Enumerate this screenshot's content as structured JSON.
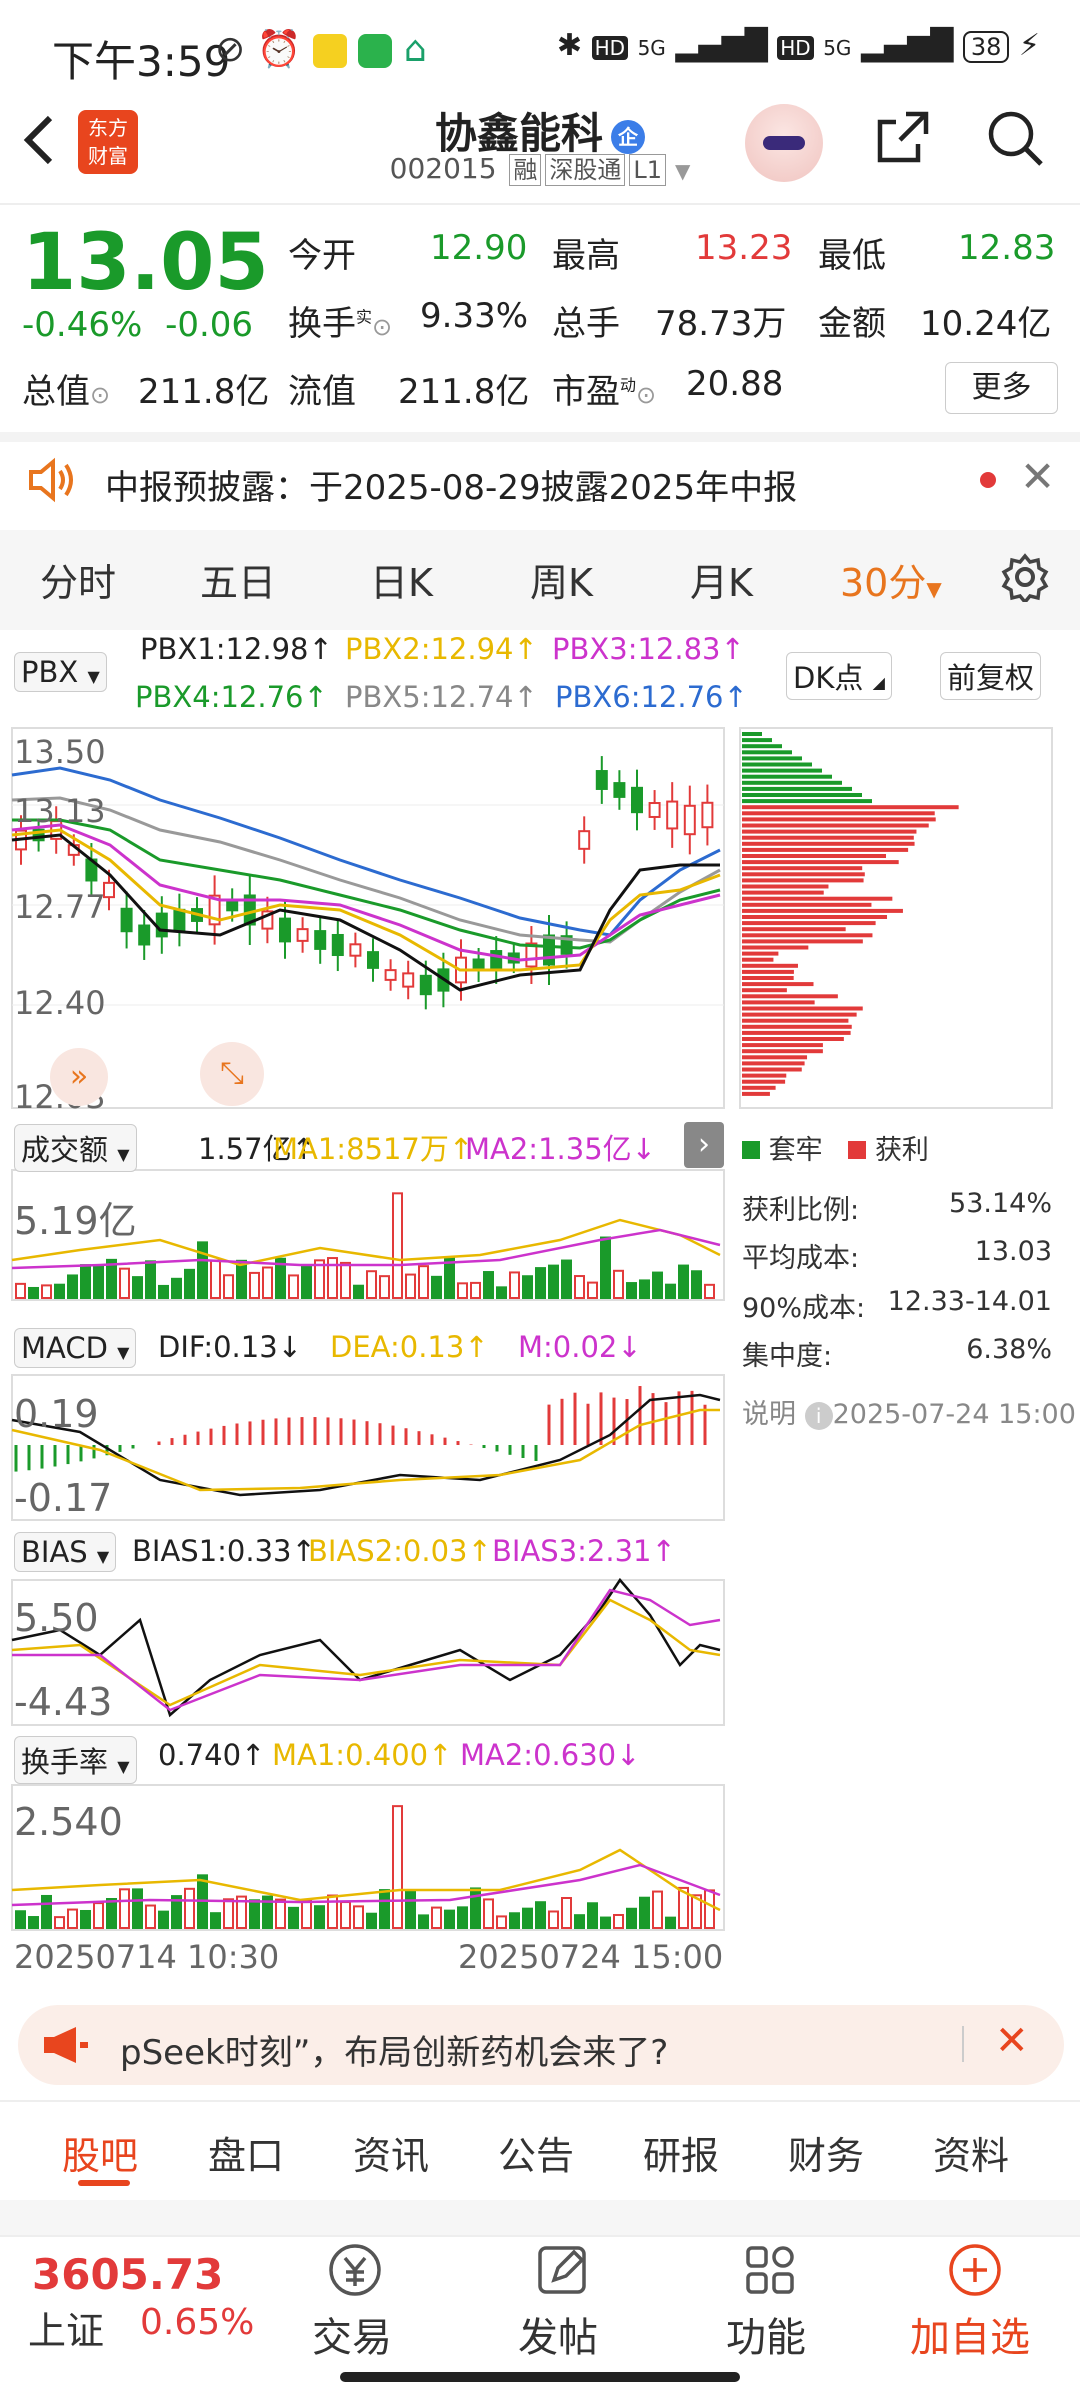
{
  "status": {
    "time": "下午3:59",
    "battery": "38",
    "net1": "5G",
    "net2": "5G",
    "hd1": "HD",
    "hd2": "HD"
  },
  "header": {
    "title": "协鑫能科",
    "qi": "企",
    "code": "002015",
    "tags": [
      "融",
      "深股通",
      "L1"
    ],
    "logo_line1": "东方",
    "logo_line2": "财富"
  },
  "quote": {
    "price": "13.05",
    "pct": "-0.46%",
    "chg": "-0.06",
    "open_k": "今开",
    "open_v": "12.90",
    "high_k": "最高",
    "high_v": "13.23",
    "low_k": "最低",
    "low_v": "12.83",
    "turn_k": "换手",
    "turn_sup": "实",
    "turn_v": "9.33%",
    "vol_k": "总手",
    "vol_v": "78.73万",
    "amt_k": "金额",
    "amt_v": "10.24亿",
    "cap_k": "总值",
    "cap_v": "211.8亿",
    "fcap_k": "流值",
    "fcap_v": "211.8亿",
    "pe_k": "市盈",
    "pe_sup": "动",
    "pe_v": "20.88",
    "more": "更多"
  },
  "notice": {
    "text": "中报预披露：于2025-08-29披露2025年中报"
  },
  "tabs": [
    "分时",
    "五日",
    "日K",
    "周K",
    "月K",
    "30分"
  ],
  "indicator": {
    "pbx": "PBX",
    "pbx1": "PBX1:12.98↑",
    "pbx2": "PBX2:12.94↑",
    "pbx3": "PBX3:12.83↑",
    "pbx4": "PBX4:12.76↑",
    "pbx5": "PBX5:12.74↑",
    "pbx6": "PBX6:12.76↑",
    "dk": "DK点",
    "fq": "前复权"
  },
  "chart_axis": {
    "y1": "13.50",
    "y2": "13.13",
    "y3": "12.77",
    "y4": "12.40",
    "y5": "12.03"
  },
  "vol": {
    "label": "成交额",
    "val": "1.57亿↑",
    "ma1": "MA1:8517万↑",
    "ma2": "MA2:1.35亿↓",
    "axis": "5.19亿"
  },
  "macd": {
    "label": "MACD",
    "dif": "DIF:0.13↓",
    "dea": "DEA:0.13↑",
    "m": "M:0.02↓",
    "a1": "0.19",
    "a2": "-0.17"
  },
  "bias": {
    "label": "BIAS",
    "b1": "BIAS1:0.33↑",
    "b2": "BIAS2:0.03↑",
    "b3": "BIAS3:2.31↑",
    "a1": "5.50",
    "a2": "-4.43"
  },
  "hsl": {
    "label": "换手率",
    "val": "0.740↑",
    "ma1": "MA1:0.400↑",
    "ma2": "MA2:0.630↓",
    "axis": "2.540"
  },
  "dates": {
    "d1": "20250714 10:30",
    "d2": "20250724 15:00"
  },
  "chip": {
    "legend1": "套牢",
    "legend2": "获利",
    "r1k": "获利比例:",
    "r1v": "53.14%",
    "r2k": "平均成本:",
    "r2v": "13.03",
    "r3k": "90%成本:",
    "r3v": "12.33-14.01",
    "r4k": "集中度:",
    "r4v": "6.38%",
    "note": "说明",
    "date": "2025-07-24 15:00"
  },
  "ad": {
    "text": "pSeek时刻”，布局创新药机会来了?"
  },
  "bottom_tabs": [
    "股吧",
    "盘口",
    "资讯",
    "公告",
    "研报",
    "财务",
    "资料"
  ],
  "bottombar": {
    "index_v": "3605.73",
    "index_k": "上证",
    "index_pct": "0.65%",
    "trade": "交易",
    "post": "发帖",
    "func": "功能",
    "add": "加自选"
  },
  "colors": {
    "up": "#e23a3a",
    "down": "#1a9a2a",
    "accent": "#e8751e"
  }
}
